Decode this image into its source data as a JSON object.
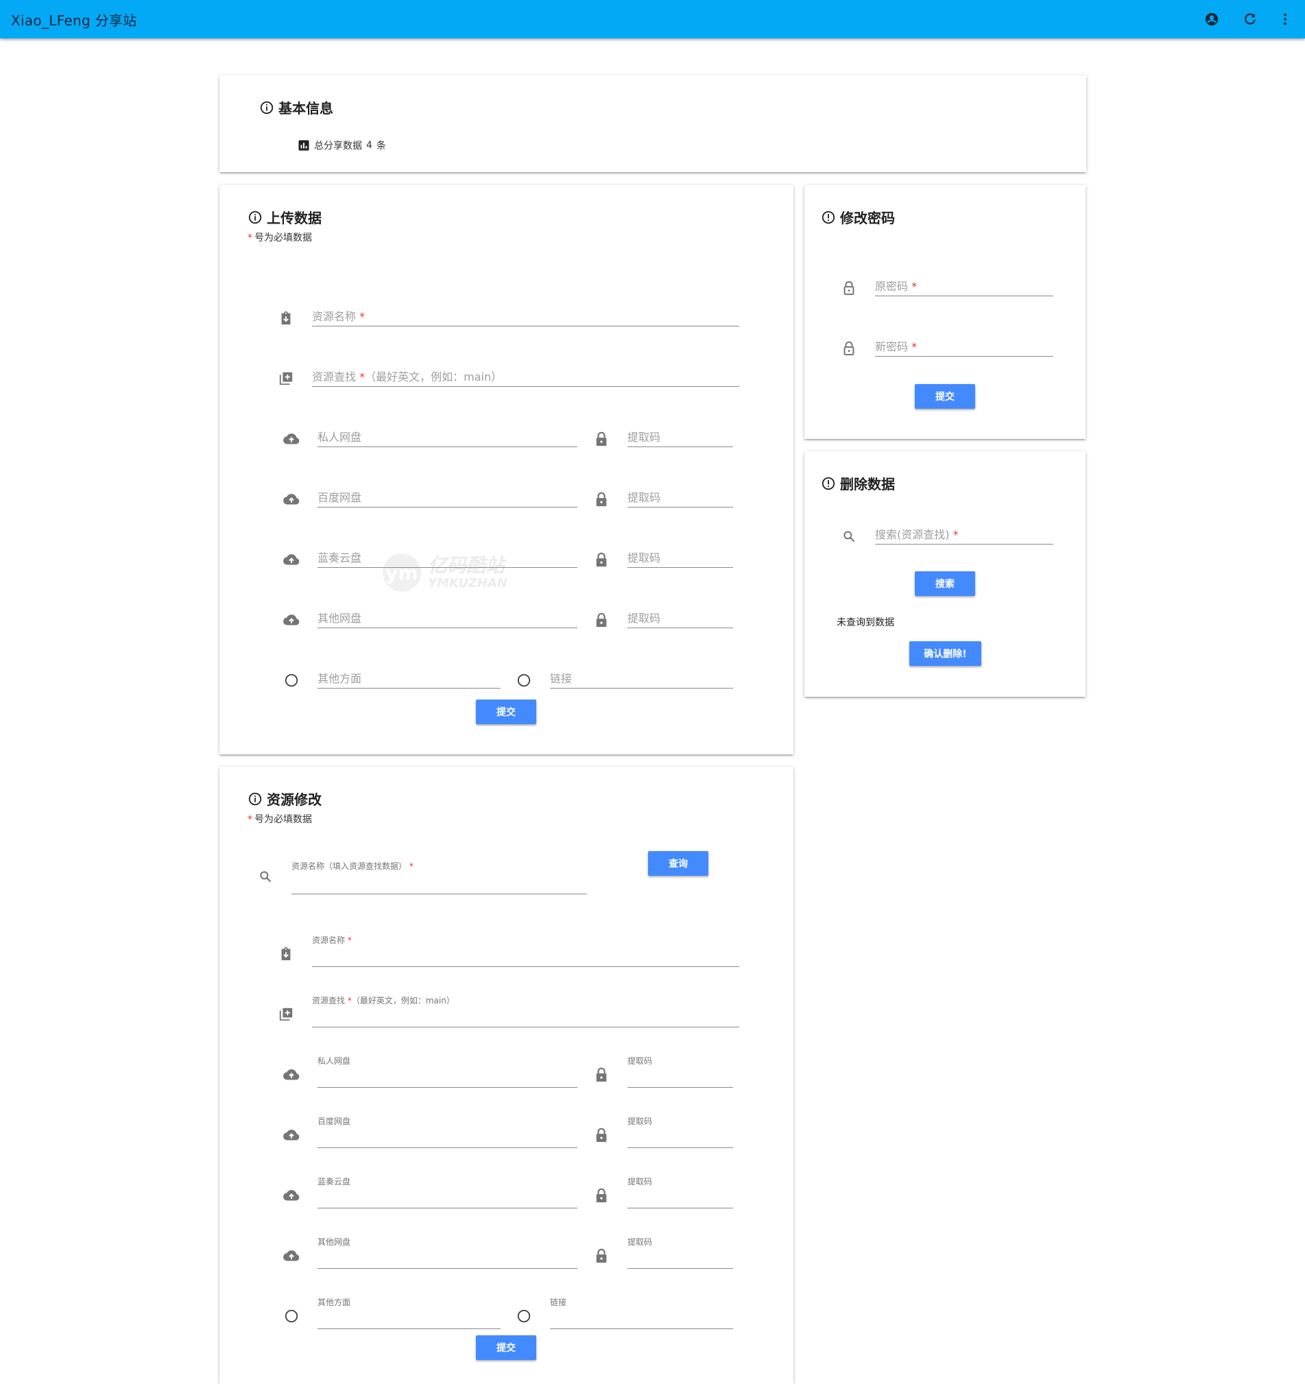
{
  "app": {
    "title": "Xiao_LFeng 分享站"
  },
  "basic": {
    "title": "基本信息",
    "stat_prefix": "总分享数据",
    "stat_count": "4",
    "stat_unit": "条"
  },
  "upload": {
    "title": "上传数据",
    "required_star": "*",
    "required_note": "号为必填数据",
    "name_ph": "资源名称",
    "key_ph": "资源查找",
    "key_hint": "（最好英文，例如：main）",
    "private_ph": "私人网盘",
    "baidu_ph": "百度网盘",
    "lanzou_ph": "蓝奏云盘",
    "other_disk_ph": "其他网盘",
    "code_ph": "提取码",
    "other_ph": "其他方面",
    "link_ph": "链接",
    "submit": "提交"
  },
  "password": {
    "title": "修改密码",
    "old_ph": "原密码",
    "new_ph": "新密码",
    "submit": "提交"
  },
  "delete": {
    "title": "删除数据",
    "search_ph": "搜索(资源查找)",
    "search_btn": "搜索",
    "status": "未查询到数据",
    "confirm": "确认删除!"
  },
  "edit": {
    "title": "资源修改",
    "required_star": "*",
    "required_note": "号为必填数据",
    "query_label": "资源名称（填入资源查找数据）",
    "query_btn": "查询",
    "name_label": "资源名称",
    "key_label": "资源查找",
    "key_hint": "（最好英文，例如：main）",
    "private_label": "私人网盘",
    "baidu_label": "百度网盘",
    "lanzou_label": "蓝奏云盘",
    "other_disk_label": "其他网盘",
    "code_label": "提取码",
    "other_label": "其他方面",
    "link_label": "链接",
    "submit": "提交"
  },
  "watermark": {
    "cn": "亿码酷站",
    "en": "YMKUZHAN"
  },
  "colors": {
    "appbar": "#03a9f4",
    "button": "#448aff",
    "required": "#e53935"
  }
}
